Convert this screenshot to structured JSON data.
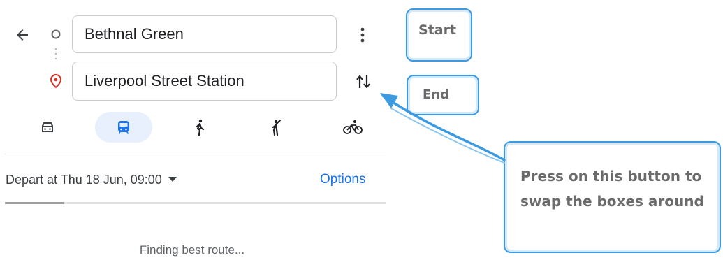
{
  "directions": {
    "start_value": "Bethnal Green",
    "end_value": "Liverpool Street Station",
    "back_icon": "arrow-left-icon",
    "more_icon": "more-vertical-icon",
    "swap_icon": "swap-vertical-icon"
  },
  "modes": [
    {
      "name": "car",
      "icon": "car-icon",
      "selected": false
    },
    {
      "name": "transit",
      "icon": "train-icon",
      "selected": true
    },
    {
      "name": "walking",
      "icon": "walking-icon",
      "selected": false
    },
    {
      "name": "ride",
      "icon": "person-waving-icon",
      "selected": false
    },
    {
      "name": "cycling",
      "icon": "bicycle-icon",
      "selected": false
    }
  ],
  "depart": {
    "label": "Depart at Thu 18 Jun, 09:00",
    "options_label": "Options"
  },
  "status": {
    "message": "Finding best route..."
  },
  "annotations": {
    "start_label": "Start",
    "end_label": "End",
    "swap_hint": "Press on this button to swap the boxes around",
    "accent_color": "#3c9be0"
  },
  "colors": {
    "primary_blue": "#1a73e8",
    "destination_red": "#d93025",
    "selected_mode_bg": "#e8f0fe"
  }
}
